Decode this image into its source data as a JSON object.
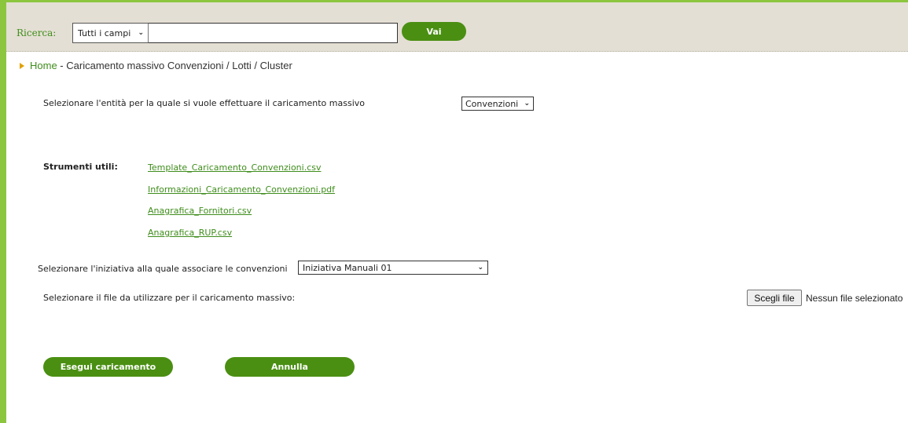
{
  "search": {
    "label": "Ricerca:",
    "field_selected": "Tutti i campi",
    "input_value": "",
    "go_label": "Vai"
  },
  "breadcrumb": {
    "home": "Home",
    "separator": " - ",
    "current": "Caricamento massivo Convenzioni / Lotti / Cluster"
  },
  "form": {
    "entity_prompt": "Selezionare l'entità per la quale si vuole effettuare il caricamento massivo",
    "entity_selected": "Convenzioni",
    "tools_label": "Strumenti utili:",
    "tools": [
      "Template_Caricamento_Convenzioni.csv",
      "Informazioni_Caricamento_Convenzioni.pdf",
      "Anagrafica_Fornitori.csv",
      "Anagrafica_RUP.csv"
    ],
    "initiative_prompt": "Selezionare l'iniziativa alla quale associare le convenzioni",
    "initiative_selected": "Iniziativa Manuali 01",
    "file_prompt": "Selezionare il file da utilizzare per il caricamento massivo:",
    "file_button": "Scegli file",
    "file_status": "Nessun file selezionato"
  },
  "actions": {
    "execute": "Esegui caricamento",
    "cancel": "Annulla"
  },
  "colors": {
    "accent_green": "#8cc63f",
    "button_green": "#4a8f12",
    "link_green": "#3f8d1c",
    "header_bg": "#e4dfd4"
  }
}
